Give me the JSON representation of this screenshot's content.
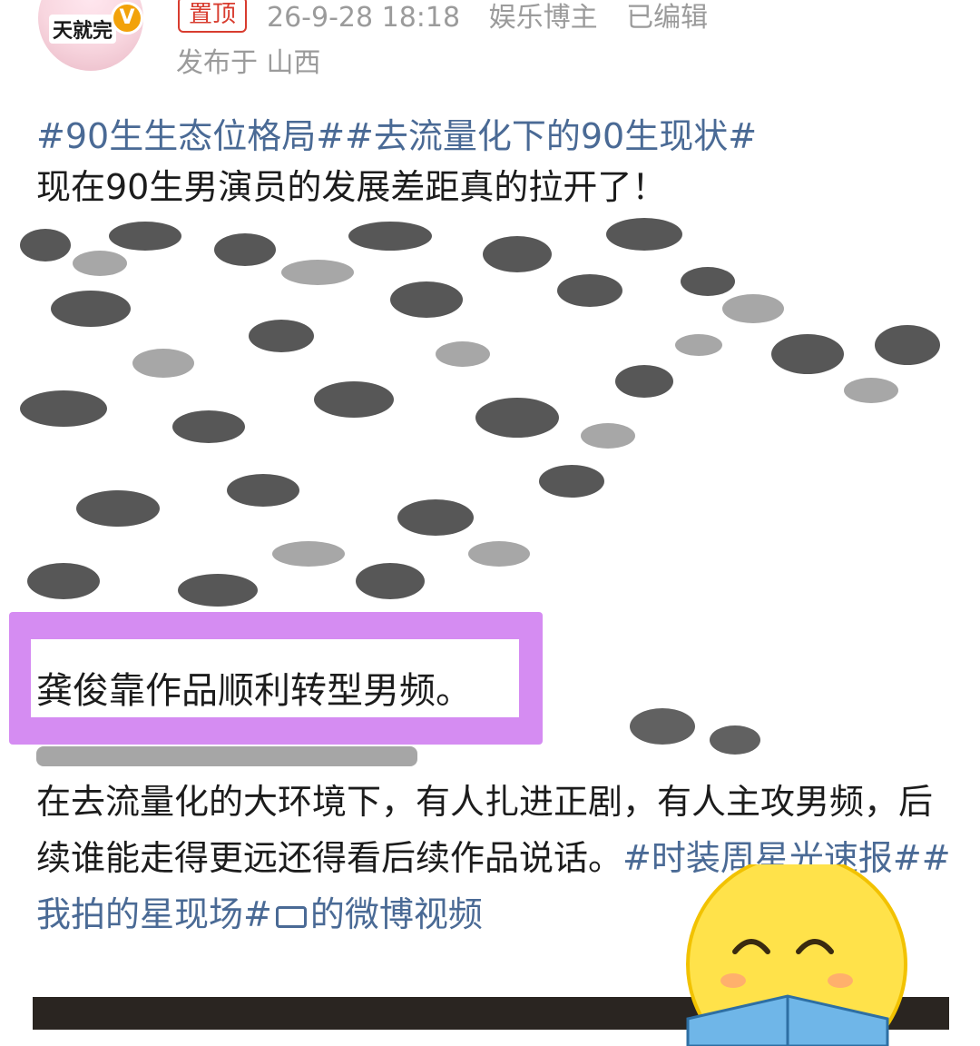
{
  "header": {
    "avatar_text": "天就完",
    "verified_badge": "V",
    "pinned_label": "置顶",
    "timestamp": "26-9-28 18:18",
    "category": "娱乐博主",
    "edited": "已编辑",
    "location": "发布于 山西"
  },
  "post": {
    "hashtags": "#90生生态位格局##去流量化下的90生现状#",
    "intro": "现在90生男演员的发展差距真的拉开了！",
    "highlighted": "龚俊靠作品顺利转型男频。",
    "body": "在去流量化的大环境下，有人扎进正剧，有人主攻男频，后续谁能走得更远还得看后续作品说话。",
    "tags_tail": "#时装周星光速报##我拍的星现场#",
    "video_suffix": "的",
    "video_label": "微博视频"
  },
  "colors": {
    "tag": "#4a6a95",
    "highlight_frame": "#d58cf2",
    "pinned": "#d83c2f",
    "meta": "#9b9b9b"
  }
}
